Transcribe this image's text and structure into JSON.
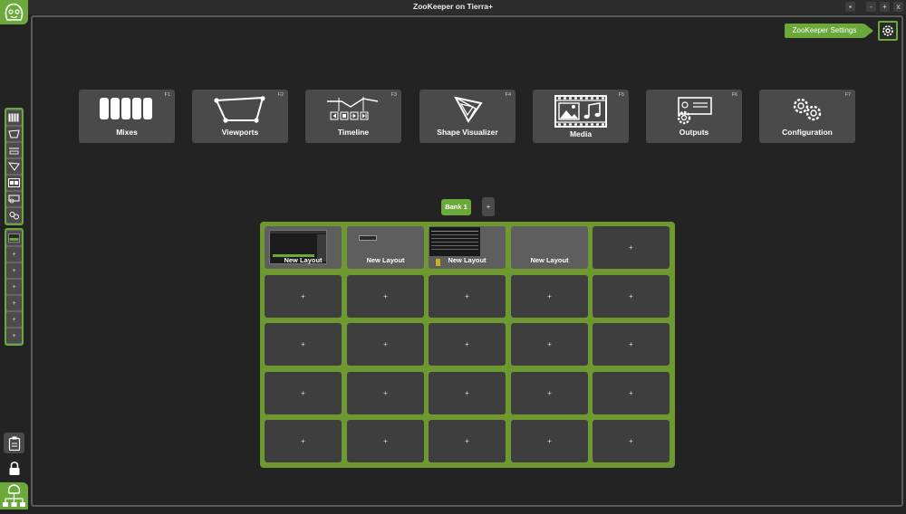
{
  "window": {
    "title": "ZooKeeper on Tierra+",
    "buttons": [
      "▪",
      "-",
      "+",
      "x"
    ]
  },
  "settings": {
    "label": "ZooKeeper Settings"
  },
  "modules": [
    {
      "label": "Mixes",
      "key": "F1",
      "icon": "mixes-icon"
    },
    {
      "label": "Viewports",
      "key": "F2",
      "icon": "viewports-icon"
    },
    {
      "label": "Timeline",
      "key": "F3",
      "icon": "timeline-icon"
    },
    {
      "label": "Shape Visualizer",
      "key": "F4",
      "icon": "shape-visualizer-icon"
    },
    {
      "label": "Media",
      "key": "F5",
      "icon": "media-icon"
    },
    {
      "label": "Outputs",
      "key": "F6",
      "icon": "outputs-icon"
    },
    {
      "label": "Configuration",
      "key": "F7",
      "icon": "configuration-icon"
    }
  ],
  "bank": {
    "label": "Bank 1",
    "add_label": "+"
  },
  "layout_grid": {
    "cells": [
      "New Layout",
      "New Layout",
      "New Layout",
      "New Layout",
      "+",
      "+",
      "+",
      "+",
      "+",
      "+",
      "+",
      "+",
      "+",
      "+",
      "+",
      "+",
      "+",
      "+",
      "+",
      "+",
      "+",
      "+",
      "+",
      "+",
      "+"
    ]
  },
  "sidebar": {
    "blank_items": [
      "+",
      "+",
      "+",
      "+",
      "+",
      "+"
    ]
  },
  "colors": {
    "accent": "#6aa93a",
    "grid": "#6e9930",
    "panel": "#4a4a4a",
    "background": "#232323"
  }
}
